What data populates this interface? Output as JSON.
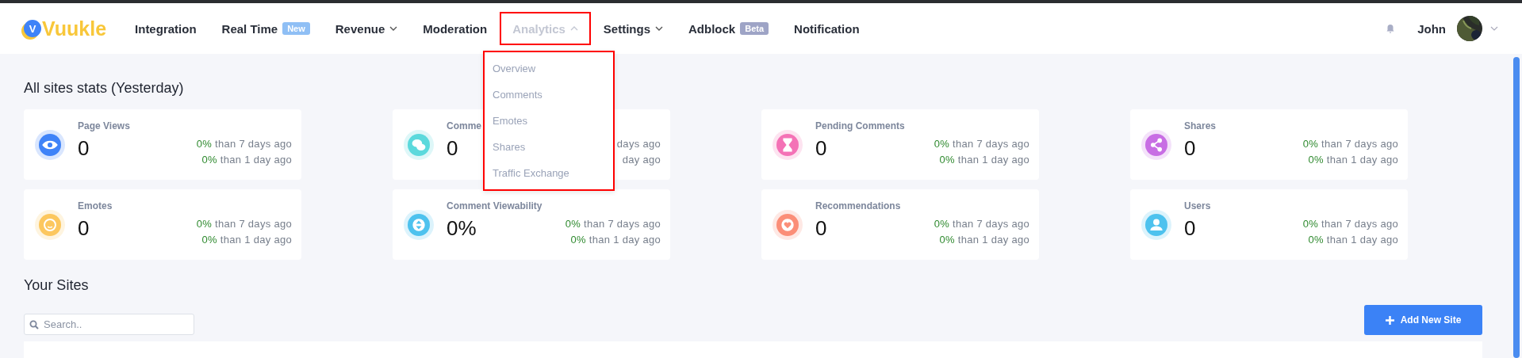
{
  "logo": {
    "mark": "V",
    "text": "Vuukle"
  },
  "nav": [
    {
      "label": "Integration",
      "selected": false
    },
    {
      "label": "Real Time",
      "badge": "New",
      "color": "#8fbff5",
      "selected": false
    },
    {
      "label": "Revenue",
      "expanded": false,
      "selected": false
    },
    {
      "label": "Moderation",
      "selected": false
    },
    {
      "label": "Analytics",
      "expanded": true,
      "selected": true,
      "menu": [
        "Overview",
        "Comments",
        "Emotes",
        "Shares",
        "Traffic Exchange"
      ]
    },
    {
      "label": "Settings",
      "expanded": false,
      "selected": false
    },
    {
      "label": "Adblock",
      "badge": "Beta",
      "color": "#9ea4c6",
      "selected": false
    },
    {
      "label": "Notification",
      "selected": false
    }
  ],
  "user": {
    "name": "John"
  },
  "stats_title": "All sites stats (Yesterday)",
  "stats": [
    {
      "title": "Page Views",
      "value": "0",
      "kind": "eye",
      "color": "#3f83f8",
      "changes": [
        {
          "pct": "0%",
          "text": "than 7 days ago"
        },
        {
          "pct": "0%",
          "text": "than 1 day ago"
        }
      ]
    },
    {
      "title": "Comme",
      "value": "0",
      "kind": "chat",
      "color": "#5cd9dc",
      "changes": [
        {
          "text": "days ago"
        },
        {
          "text": "day ago"
        }
      ]
    },
    {
      "title": "Pending Comments",
      "value": "0",
      "kind": "hourglass",
      "color": "#f472b6",
      "changes": [
        {
          "pct": "0%",
          "text": "than 7 days ago"
        },
        {
          "pct": "0%",
          "text": "than 1 day ago"
        }
      ]
    },
    {
      "title": "Shares",
      "value": "0",
      "kind": "share",
      "color": "#c86ee4",
      "changes": [
        {
          "pct": "0%",
          "text": "than 7 days ago"
        },
        {
          "pct": "0%",
          "text": "than 1 day ago"
        }
      ]
    },
    {
      "title": "Emotes",
      "value": "0",
      "kind": "smile",
      "color": "#fcc75e",
      "changes": [
        {
          "pct": "0%",
          "text": "than 7 days ago"
        },
        {
          "pct": "0%",
          "text": "than 1 day ago"
        }
      ]
    },
    {
      "title": "Comment Viewability",
      "value": "0%",
      "kind": "updown",
      "color": "#4ec2ee",
      "changes": [
        {
          "pct": "0%",
          "text": "than 7 days ago"
        },
        {
          "pct": "0%",
          "text": "than 1 day ago"
        }
      ]
    },
    {
      "title": "Recommendations",
      "value": "0",
      "kind": "heart",
      "color": "#fb8e78",
      "changes": [
        {
          "pct": "0%",
          "text": "than 7 days ago"
        },
        {
          "pct": "0%",
          "text": "than 1 day ago"
        }
      ]
    },
    {
      "title": "Users",
      "value": "0",
      "kind": "user",
      "color": "#4ec2ee",
      "changes": [
        {
          "pct": "0%",
          "text": "than 7 days ago"
        },
        {
          "pct": "0%",
          "text": "than 1 day ago"
        }
      ]
    }
  ],
  "sites_title": "Your Sites",
  "search": {
    "placeholder": "Search.."
  },
  "add_button": {
    "label": "Add New Site"
  }
}
